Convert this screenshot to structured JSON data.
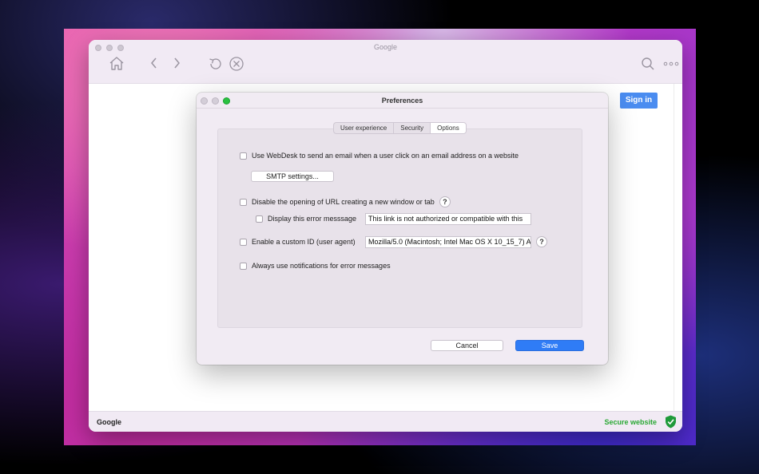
{
  "browser": {
    "title": "Google",
    "toolbar": {
      "home_icon": "home-icon",
      "back_icon": "chevron-left-icon",
      "forward_icon": "chevron-right-icon",
      "reload_icon": "reload-icon",
      "stop_icon": "stop-icon",
      "search_icon": "search-icon",
      "more_icon": "more-icon"
    },
    "sign_in_label": "Sign in",
    "accent_color": "#4a8cf0"
  },
  "status_bar": {
    "left_text": "Google",
    "right_text": "Secure website",
    "secure_color": "#2aa834",
    "icon": "shield-check-icon"
  },
  "dialog": {
    "title": "Preferences",
    "tabs": [
      {
        "label": "User experience",
        "active": false
      },
      {
        "label": "Security",
        "active": false
      },
      {
        "label": "Options",
        "active": true
      }
    ],
    "options": {
      "email_option": {
        "label": "Use WebDesk to send an email when a user click on an email address on a website",
        "checked": false
      },
      "smtp_button": "SMTP settings...",
      "disable_url_option": {
        "label": "Disable the opening of URL creating a new window or tab",
        "checked": false
      },
      "error_message_option": {
        "label": "Display this error messsage",
        "checked": false
      },
      "error_message_value": "This link is not authorized or compatible with this",
      "custom_id_option": {
        "label": "Enable a custom ID (user agent)",
        "checked": false
      },
      "custom_id_value": "Mozilla/5.0 (Macintosh; Intel Mac OS X 10_15_7) A",
      "notifications_option": {
        "label": "Always use notifications for error messages",
        "checked": false
      },
      "help_label": "?"
    },
    "cancel_label": "Cancel",
    "save_label": "Save",
    "save_color": "#2f7cf6"
  }
}
